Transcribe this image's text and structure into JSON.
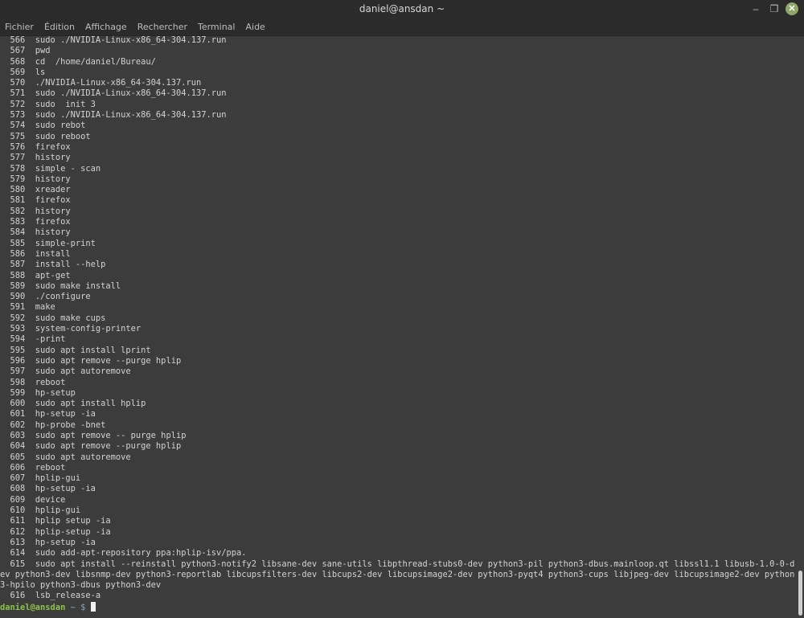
{
  "window": {
    "title": "daniel@ansdan ~"
  },
  "menu": [
    "Fichier",
    "Édition",
    "Affichage",
    "Rechercher",
    "Terminal",
    "Aide"
  ],
  "history": [
    "  566  sudo ./NVIDIA-Linux-x86_64-304.137.run",
    "  567  pwd",
    "  568  cd  /home/daniel/Bureau/",
    "  569  ls",
    "  570  ./NVIDIA-Linux-x86_64-304.137.run",
    "  571  sudo ./NVIDIA-Linux-x86_64-304.137.run",
    "  572  sudo  init 3",
    "  573  sudo ./NVIDIA-Linux-x86_64-304.137.run",
    "  574  sudo rebot",
    "  575  sudo reboot",
    "  576  firefox",
    "  577  history",
    "  578  simple - scan",
    "  579  history",
    "  580  xreader",
    "  581  firefox",
    "  582  history",
    "  583  firefox",
    "  584  history",
    "  585  simple-print",
    "  586  install",
    "  587  install --help",
    "  588  apt-get",
    "  589  sudo make install",
    "  590  ./configure",
    "  591  make",
    "  592  sudo make cups",
    "  593  system-config-printer",
    "  594  -print",
    "  595  sudo apt install lprint",
    "  596  sudo apt remove --purge hplip",
    "  597  sudo apt autoremove",
    "  598  reboot",
    "  599  hp-setup",
    "  600  sudo apt install hplip",
    "  601  hp-setup -ia",
    "  602  hp-probe -bnet",
    "  603  sudo apt remove -- purge hplip",
    "  604  sudo apt remove --purge hplip",
    "  605  sudo apt autoremove",
    "  606  reboot",
    "  607  hplip-gui",
    "  608  hp-setup -ia",
    "  609  device",
    "  610  hplip-gui",
    "  611  hplip setup -ia",
    "  612  hplip-setup -ia",
    "  613  hp-setup -ia",
    "  614  sudo add-apt-repository ppa:hplip-isv/ppa.",
    "  615  sudo apt install --reinstall python3-notify2 libsane-dev sane-utils libpthread-stubs0-dev python3-pil python3-dbus.mainloop.qt libssl1.1 libusb-1.0-0-dev python3-dev libsnmp-dev python3-reportlab libcupsfilters-dev libcups2-dev libcupsimage2-dev python3-pyqt4 python3-cups libjpeg-dev libcupsimage2-dev python3-hpilo python3-dbus python3-dev",
    "  616  lsb_release-a"
  ],
  "prompt": {
    "user": "daniel@ansdan",
    "rest": " ~ $ "
  }
}
